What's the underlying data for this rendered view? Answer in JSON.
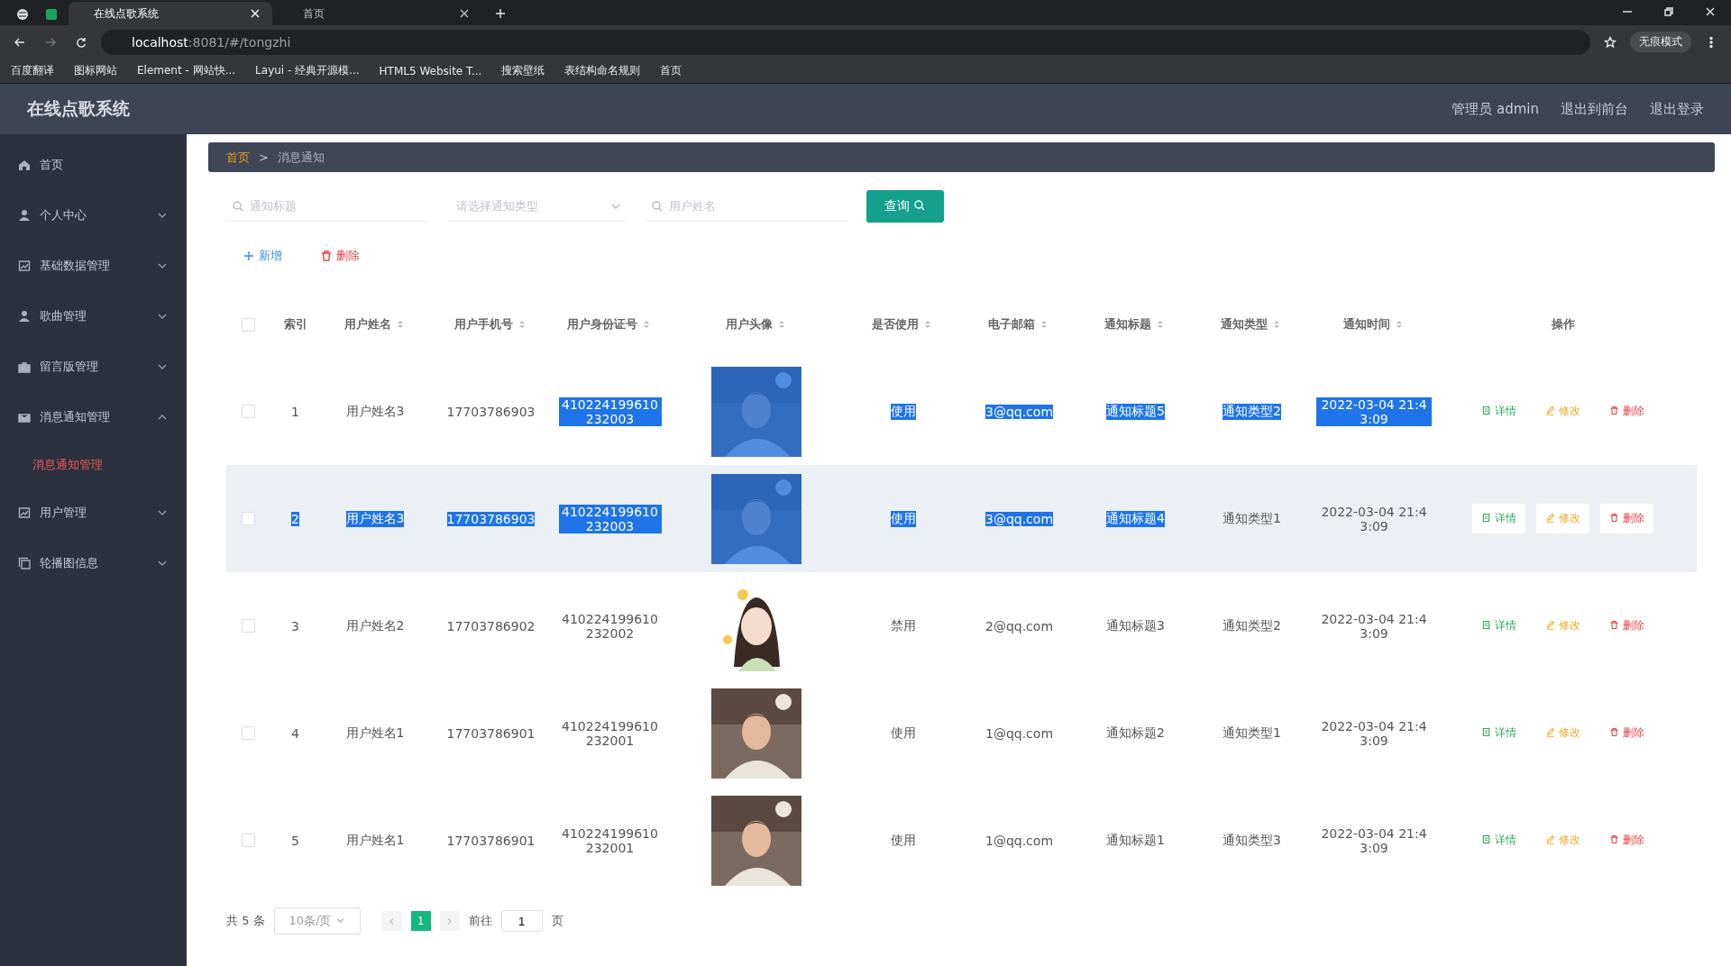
{
  "browser": {
    "tabs": [
      {
        "title": "在线点歌系统",
        "selected": true
      },
      {
        "title": "首页",
        "selected": false
      }
    ],
    "url_host": "localhost",
    "url_rest": ":8081/#/tongzhi",
    "profile": "无痕模式",
    "bookmarks": [
      {
        "label": "百度翻译"
      },
      {
        "label": "图标网站"
      },
      {
        "label": "Element - 网站快..."
      },
      {
        "label": "Layui - 经典开源模..."
      },
      {
        "label": "HTML5 Website T..."
      },
      {
        "label": "搜索壁纸"
      },
      {
        "label": "表结构命名规则"
      },
      {
        "label": "首页"
      }
    ]
  },
  "header": {
    "title": "在线点歌系统",
    "links": [
      "管理员 admin",
      "退出到前台",
      "退出登录"
    ]
  },
  "sidebar": {
    "items": [
      {
        "label": "首页",
        "kind": "link"
      },
      {
        "label": "个人中心",
        "kind": "group",
        "expanded": false
      },
      {
        "label": "基础数据管理",
        "kind": "group",
        "expanded": false
      },
      {
        "label": "歌曲管理",
        "kind": "group",
        "expanded": false
      },
      {
        "label": "留言版管理",
        "kind": "group",
        "expanded": false
      },
      {
        "label": "消息通知管理",
        "kind": "group",
        "expanded": true,
        "children": [
          {
            "label": "消息通知管理",
            "selected": true
          }
        ]
      },
      {
        "label": "用户管理",
        "kind": "group",
        "expanded": false
      },
      {
        "label": "轮播图信息",
        "kind": "group",
        "expanded": false
      }
    ]
  },
  "breadcrumb": [
    {
      "label": "首页",
      "current": false
    },
    {
      "label": "消息通知",
      "current": true
    }
  ],
  "breadcrumb_separator": ">",
  "search": {
    "fields": [
      {
        "kind": "text",
        "placeholder": "通知标题"
      },
      {
        "kind": "select",
        "placeholder": "请选择通知类型"
      },
      {
        "kind": "text",
        "placeholder": "用户姓名"
      }
    ],
    "button": "查询"
  },
  "actions": [
    {
      "kind": "add",
      "label": "新增"
    },
    {
      "kind": "delete",
      "label": "删除"
    }
  ],
  "table": {
    "select_all": {
      "checked": false
    },
    "columns": [
      {
        "label": "索引",
        "sortable": false
      },
      {
        "label": "用户姓名",
        "sortable": true
      },
      {
        "label": "用户手机号",
        "sortable": true
      },
      {
        "label": "用户身份证号",
        "sortable": true
      },
      {
        "label": "用户头像",
        "sortable": true
      },
      {
        "label": "是否使用",
        "sortable": true
      },
      {
        "label": "电子邮箱",
        "sortable": true
      },
      {
        "label": "通知标题",
        "sortable": true
      },
      {
        "label": "通知类型",
        "sortable": true
      },
      {
        "label": "通知时间",
        "sortable": true
      },
      {
        "label": "操作",
        "sortable": false
      }
    ],
    "rows": [
      {
        "checked": false,
        "hovered": false,
        "cells": [
          {
            "text": "1",
            "highlighted": false
          },
          {
            "text": "用户姓名3",
            "highlighted": false
          },
          {
            "text": "17703786903",
            "highlighted": false
          },
          {
            "text": "410224199610232003",
            "highlighted": true
          },
          {
            "kind": "picture",
            "highlighted": true
          },
          {
            "text": "使用",
            "highlighted": true
          },
          {
            "text": "3@qq.com",
            "highlighted": true
          },
          {
            "text": "通知标题5",
            "highlighted": true
          },
          {
            "text": "通知类型2",
            "highlighted": true
          },
          {
            "text": "2022-03-04 21:43:09",
            "highlighted": true
          }
        ],
        "actions": [
          "详情",
          "修改",
          "删除"
        ]
      },
      {
        "checked": false,
        "hovered": true,
        "cells": [
          {
            "text": "2",
            "highlighted": true
          },
          {
            "text": "用户姓名3",
            "highlighted": true
          },
          {
            "text": "17703786903",
            "highlighted": true
          },
          {
            "text": "410224199610232003",
            "highlighted": true
          },
          {
            "kind": "picture",
            "highlighted": true
          },
          {
            "text": "使用",
            "highlighted": true
          },
          {
            "text": "3@qq.com",
            "highlighted": true
          },
          {
            "text": "通知标题4",
            "highlighted": true
          },
          {
            "text": "通知类型1",
            "highlighted": false
          },
          {
            "text": "2022-03-04 21:43:09",
            "highlighted": false
          }
        ],
        "actions": [
          "详情",
          "修改",
          "删除"
        ]
      },
      {
        "checked": false,
        "hovered": false,
        "cells": [
          {
            "text": "3",
            "highlighted": false
          },
          {
            "text": "用户姓名2",
            "highlighted": false
          },
          {
            "text": "17703786902",
            "highlighted": false
          },
          {
            "text": "410224199610232002",
            "highlighted": false
          },
          {
            "kind": "picture",
            "highlighted": false
          },
          {
            "text": "禁用",
            "highlighted": false
          },
          {
            "text": "2@qq.com",
            "highlighted": false
          },
          {
            "text": "通知标题3",
            "highlighted": false
          },
          {
            "text": "通知类型2",
            "highlighted": false
          },
          {
            "text": "2022-03-04 21:43:09",
            "highlighted": false
          }
        ],
        "actions": [
          "详情",
          "修改",
          "删除"
        ]
      },
      {
        "checked": false,
        "hovered": false,
        "cells": [
          {
            "text": "4",
            "highlighted": false
          },
          {
            "text": "用户姓名1",
            "highlighted": false
          },
          {
            "text": "17703786901",
            "highlighted": false
          },
          {
            "text": "410224199610232001",
            "highlighted": false
          },
          {
            "kind": "picture",
            "highlighted": false
          },
          {
            "text": "使用",
            "highlighted": false
          },
          {
            "text": "1@qq.com",
            "highlighted": false
          },
          {
            "text": "通知标题2",
            "highlighted": false
          },
          {
            "text": "通知类型1",
            "highlighted": false
          },
          {
            "text": "2022-03-04 21:43:09",
            "highlighted": false
          }
        ],
        "actions": [
          "详情",
          "修改",
          "删除"
        ]
      },
      {
        "checked": false,
        "hovered": false,
        "cells": [
          {
            "text": "5",
            "highlighted": false
          },
          {
            "text": "用户姓名1",
            "highlighted": false
          },
          {
            "text": "17703786901",
            "highlighted": false
          },
          {
            "text": "410224199610232001",
            "highlighted": false
          },
          {
            "kind": "picture",
            "highlighted": false
          },
          {
            "text": "使用",
            "highlighted": false
          },
          {
            "text": "1@qq.com",
            "highlighted": false
          },
          {
            "text": "通知标题1",
            "highlighted": false
          },
          {
            "text": "通知类型3",
            "highlighted": false
          },
          {
            "text": "2022-03-04 21:43:09",
            "highlighted": false
          }
        ],
        "actions": [
          "详情",
          "修改",
          "删除"
        ]
      }
    ]
  },
  "pagination": {
    "total": "共 5 条",
    "page_size": "10条/页",
    "pages": [
      {
        "label": "1",
        "selected": true
      }
    ],
    "goto_label": "前往",
    "goto_value": "1",
    "goto_suffix": "页"
  }
}
